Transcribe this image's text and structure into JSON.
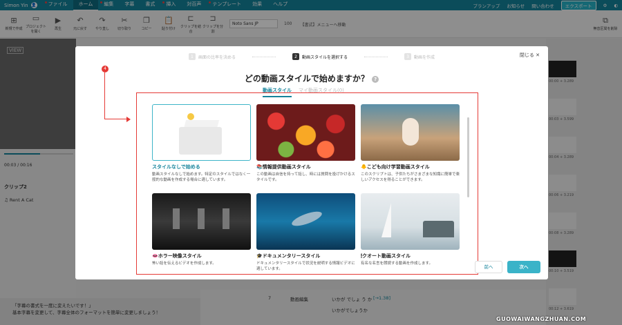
{
  "menubar": {
    "user": "Simon Yin",
    "items": [
      "ファイル",
      "ホーム",
      "編集",
      "字幕",
      "書式",
      "挿入",
      "対百声",
      "テンプレート",
      "効果",
      "ヘルプ"
    ],
    "active": "ホーム",
    "right": [
      "プランアップ",
      "お知らせ",
      "問い合わせ"
    ],
    "export": "エクスポート"
  },
  "toolbar": {
    "tools": [
      {
        "icon": "plus-box",
        "label": "新規で作成"
      },
      {
        "icon": "folder",
        "label": "プロジェクトを開く"
      },
      {
        "icon": "play",
        "label": "再生"
      },
      {
        "icon": "undo",
        "label": "元に戻す"
      },
      {
        "icon": "redo",
        "label": "やり直し"
      },
      {
        "icon": "scissors",
        "label": "切り取り"
      },
      {
        "icon": "copy",
        "label": "コピー"
      },
      {
        "icon": "paste",
        "label": "貼り付け"
      },
      {
        "icon": "split",
        "label": "クリップを結合"
      },
      {
        "icon": "split2",
        "label": "クリップを分割"
      }
    ],
    "font": "Noto Sans JP",
    "font_size": "100",
    "font_menu": "【書式】メニューへ移動",
    "right_tool": "無音区間を削除"
  },
  "left": {
    "logo": "VIEW",
    "time": "00:03 / 00:16",
    "progress": 0.52,
    "clip_head": "クリップ2",
    "clip_item": "Rent A Cat",
    "tip_title": "「字幕の書式を一度に変えたいです！」",
    "tip_body": "基本字幕を変更して、字幕全体のフォーマットを簡単に変更しましょう！"
  },
  "rows": {
    "row_num": "7",
    "row_label": "動画編集",
    "row_text": "いかが でしょ う か",
    "row_tag": "[→1.38]",
    "row_text2": "いかがでしょうか"
  },
  "thumbs": [
    "00:00 + 3.289",
    "00:03 + 3.599",
    "00:04 + 3.289",
    "00:06 + 3.219",
    "00:08 + 3.289",
    "00:10 + 3.519",
    "00:12 + 3.619"
  ],
  "modal": {
    "steps": [
      {
        "num": "1",
        "label": "画面の比率を決める"
      },
      {
        "num": "2",
        "label": "動画スタイルを選択する"
      },
      {
        "num": "3",
        "label": "動画を作成"
      }
    ],
    "active_step": 1,
    "close": "閉じる",
    "title": "どの動画スタイルで始めますか？",
    "help": "?",
    "tabs": [
      "動画スタイル",
      "マイ動画スタイル(0)"
    ],
    "marker": "4",
    "cards": [
      {
        "title": "スタイルなしで始める",
        "desc": "動画スタイルなしで始めます。特定のスタイルではなく一般的な動画を作成する場合に適しています。",
        "icon": ""
      },
      {
        "title": "情報提供動画スタイル",
        "desc": "この動画は自信を持って話し、時には質問を投げかけるスタイルです。",
        "icon": "📚"
      },
      {
        "title": "こども向け学習動画スタイル",
        "desc": "このスクリプトは、子供たちがさまざまな知識に簡単で楽しいアクセスを得ることができます。",
        "icon": "🐥"
      },
      {
        "title": "ホラー映像スタイル",
        "desc": "怖い話を伝えるビデオを作成します。",
        "icon": "👄"
      },
      {
        "title": "ドキュメンタリースタイル",
        "desc": "ドキュメンタリースタイルで状況を説明する情報ビデオに適しています。",
        "icon": "🎓"
      },
      {
        "title": "クオート動画スタイル",
        "desc": "有名な名言を朗読する動画を作成します。",
        "icon": "🕯"
      }
    ],
    "prev": "前へ",
    "next": "次へ"
  },
  "watermark": "GUOWAIWANGZHUAN.COM"
}
